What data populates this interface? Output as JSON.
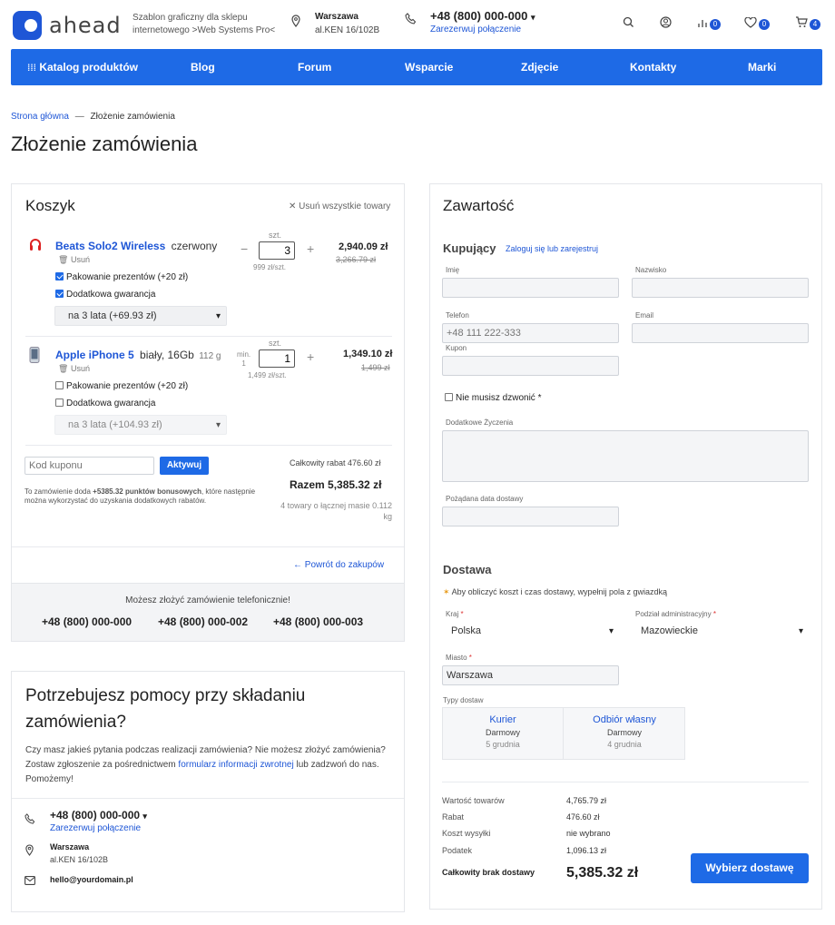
{
  "header": {
    "logo_text": "ahead",
    "tagline": "Szablon graficzny dla sklepu internetowego >Web Systems Pro<",
    "city": "Warszawa",
    "address": "al.KEN 16/102B",
    "phone": "+48 (800) 000-000",
    "reserve_call": "Zarezerwuj połączenie",
    "compare_count": "0",
    "wishlist_count": "0",
    "cart_count": "4"
  },
  "nav": {
    "items": [
      "Katalog produktów",
      "Blog",
      "Forum",
      "Wsparcie",
      "Zdjęcie",
      "Kontakty",
      "Marki"
    ]
  },
  "breadcrumb": {
    "home": "Strona główna",
    "separator": "—",
    "current": "Złożenie zamówienia"
  },
  "page_title": "Złożenie zamówienia",
  "cart": {
    "title": "Koszyk",
    "clear_all": "Usuń wszystkie towary",
    "items": [
      {
        "name": "Beats Solo2 Wireless",
        "variant": "czerwony",
        "remove": "Usuń",
        "unit": "szt.",
        "qty": "3",
        "unit_price": "999 zł/szt.",
        "price": "2,940.09 zł",
        "old_price": "3,266.79 zł",
        "opt_gift": "Pakowanie prezentów (+20 zł)",
        "opt_warranty": "Dodatkowa gwarancja",
        "warranty_select": "na 3 lata (+69.93 zł)",
        "gift_checked": true,
        "warranty_checked": true
      },
      {
        "name": "Apple iPhone 5",
        "variant": "biały, 16Gb",
        "weight": "112 g",
        "remove": "Usuń",
        "unit": "szt.",
        "min_label": "min.",
        "min_value": "1",
        "qty": "1",
        "unit_price": "1,499 zł/szt.",
        "price": "1,349.10 zł",
        "old_price": "1,499 zł",
        "opt_gift": "Pakowanie prezentów (+20 zł)",
        "opt_warranty": "Dodatkowa gwarancja",
        "warranty_select": "na 3 lata (+104.93 zł)",
        "gift_checked": false,
        "warranty_checked": false
      }
    ],
    "coupon_placeholder": "Kod kuponu",
    "apply_button": "Aktywuj",
    "bonus_pre": "To zamówienie doda ",
    "bonus_points": "+5385.32 punktów bonusowych",
    "bonus_post": ", które następnie można wykorzystać do uzyskania dodatkowych rabatów.",
    "total_discount": "Całkowity rabat 476.60 zł",
    "total": "Razem 5,385.32 zł",
    "items_info": "4 towary o łącznej masie 0.112 kg",
    "back_link": "← Powrót do zakupów",
    "phone_order_text": "Możesz złożyć zamówienie telefonicznie!",
    "phones": [
      "+48 (800) 000-000",
      "+48 (800) 000-002",
      "+48 (800) 000-003"
    ]
  },
  "help": {
    "title": "Potrzebujesz pomocy przy składaniu zamówienia?",
    "text_pre": "Czy masz jakieś pytania podczas realizacji zamówienia? Nie możesz złożyć zamówienia? Zostaw zgłoszenie za pośrednictwem ",
    "text_link": "formularz informacji zwrotnej",
    "text_post": " lub zadzwoń do nas. Pomożemy!",
    "phone": "+48 (800) 000-000",
    "reserve_call": "Zarezerwuj połączenie",
    "city": "Warszawa",
    "address": "al.KEN 16/102B",
    "email": "hello@yourdomain.pl"
  },
  "order": {
    "title": "Zawartość",
    "buyer_title": "Kupujący",
    "login_link": "Zaloguj się lub zarejestruj",
    "labels": {
      "first_name": "Imię",
      "last_name": "Nazwisko",
      "phone": "Telefon",
      "email": "Email",
      "coupon": "Kupon",
      "no_call": "Nie musisz dzwonić",
      "wishes": "Dodatkowe Życzenia",
      "delivery_date": "Pożądana data dostawy"
    },
    "phone_placeholder": "+48 111 222-333",
    "delivery_title": "Dostawa",
    "delivery_hint": "Aby obliczyć koszt i czas dostawy, wypełnij pola z gwiazdką",
    "country_label": "Kraj",
    "country": "Polska",
    "region_label": "Podział administracyjny",
    "region": "Mazowieckie",
    "city_label": "Miasto",
    "city": "Warszawa",
    "delivery_types_label": "Typy dostaw",
    "delivery_types": [
      {
        "name": "Kurier",
        "price": "Darmowy",
        "date": "5 grudnia"
      },
      {
        "name": "Odbiór własny",
        "price": "Darmowy",
        "date": "4 grudnia"
      }
    ],
    "summary": [
      {
        "label": "Wartość towarów",
        "value": "4,765.79 zł"
      },
      {
        "label": "Rabat",
        "value": "476.60 zł"
      },
      {
        "label": "Koszt wysyłki",
        "value": "nie wybrano"
      },
      {
        "label": "Podatek",
        "value": "1,096.13 zł"
      }
    ],
    "total_label": "Całkowity brak dostawy",
    "total_value": "5,385.32 zł",
    "choose_delivery_button": "Wybierz dostawę"
  }
}
